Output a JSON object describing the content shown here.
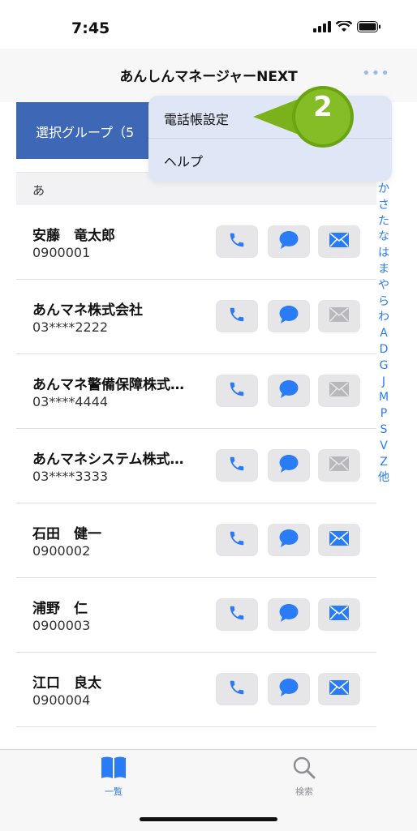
{
  "status": {
    "time": "7:45"
  },
  "nav": {
    "title": "あんしんマネージャーNEXT",
    "more": "•••"
  },
  "group": {
    "label": "選択グループ（5"
  },
  "section": {
    "label": "あ"
  },
  "contacts": [
    {
      "name": "安藤　竜太郎",
      "phone": "0900001",
      "mail_active": true
    },
    {
      "name": "あんマネ株式会社",
      "phone": "03****2222",
      "mail_active": false
    },
    {
      "name": "あんマネ警備保障株式…",
      "phone": "03****4444",
      "mail_active": false
    },
    {
      "name": "あんマネシステム株式…",
      "phone": "03****3333",
      "mail_active": false
    },
    {
      "name": "石田　健一",
      "phone": "0900002",
      "mail_active": true
    },
    {
      "name": "浦野　仁",
      "phone": "0900003",
      "mail_active": true
    },
    {
      "name": "江口　良太",
      "phone": "0900004",
      "mail_active": true
    }
  ],
  "index": [
    "か",
    "さ",
    "た",
    "な",
    "は",
    "ま",
    "や",
    "ら",
    "わ",
    "A",
    "D",
    "G",
    "J",
    "M",
    "P",
    "S",
    "V",
    "Z",
    "他"
  ],
  "menu": {
    "item1": "電話帳設定",
    "item2": "ヘルプ"
  },
  "badge": {
    "number": "2"
  },
  "tabs": {
    "list": "一覧",
    "search": "検索"
  },
  "colors": {
    "accent": "#2a7bf6",
    "group_bg": "#3e68b6",
    "badge": "#7bb21c"
  }
}
